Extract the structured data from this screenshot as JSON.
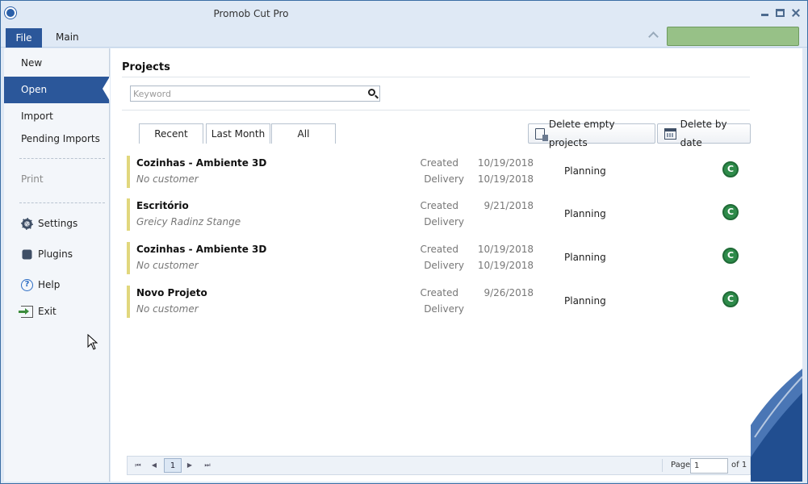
{
  "window": {
    "title": "Promob Cut Pro"
  },
  "menu": {
    "file_tab": "File",
    "main_tab": "Main"
  },
  "sidebar": {
    "items": [
      {
        "label": "New",
        "icon": ""
      },
      {
        "label": "Open",
        "icon": ""
      },
      {
        "label": "Import",
        "icon": ""
      },
      {
        "label": "Pending Imports",
        "icon": ""
      },
      {
        "label": "Print",
        "icon": ""
      },
      {
        "label": "Settings",
        "icon": "gear-icon"
      },
      {
        "label": "Plugins",
        "icon": "puzzle-icon"
      },
      {
        "label": "Help",
        "icon": "help-icon"
      },
      {
        "label": "Exit",
        "icon": "exit-icon"
      }
    ],
    "active": "Open"
  },
  "main": {
    "title": "Projects",
    "search": {
      "placeholder": "Keyword",
      "value": ""
    },
    "filter_tabs": [
      "Recent",
      "Last Month",
      "All"
    ],
    "actions": {
      "delete_empty": "Delete empty projects",
      "delete_by_date": "Delete by date"
    },
    "projects": [
      {
        "name": "Cozinhas - Ambiente 3D",
        "customer": "No customer",
        "created_label": "Created",
        "created": "10/19/2018",
        "delivery_label": "Delivery",
        "delivery": "10/19/2018",
        "status": "Planning",
        "badge": "C"
      },
      {
        "name": "Escritório",
        "customer": "Greicy Radinz Stange",
        "created_label": "Created",
        "created": "9/21/2018",
        "delivery_label": "Delivery",
        "delivery": "",
        "status": "Planning",
        "badge": "C"
      },
      {
        "name": "Cozinhas - Ambiente 3D",
        "customer": "No customer",
        "created_label": "Created",
        "created": "10/19/2018",
        "delivery_label": "Delivery",
        "delivery": "10/19/2018",
        "status": "Planning",
        "badge": "C"
      },
      {
        "name": "Novo Projeto",
        "customer": "No customer",
        "created_label": "Created",
        "created": "9/26/2018",
        "delivery_label": "Delivery",
        "delivery": "",
        "status": "Planning",
        "badge": "C"
      }
    ],
    "pager": {
      "current": "1",
      "page_label": "Page",
      "page_value": "1",
      "of_label": "of 1"
    }
  },
  "colors": {
    "accent": "#2b579a",
    "status_green": "#97c187",
    "row_marker": "#e1d77d",
    "badge_green": "#2e8b4a"
  }
}
